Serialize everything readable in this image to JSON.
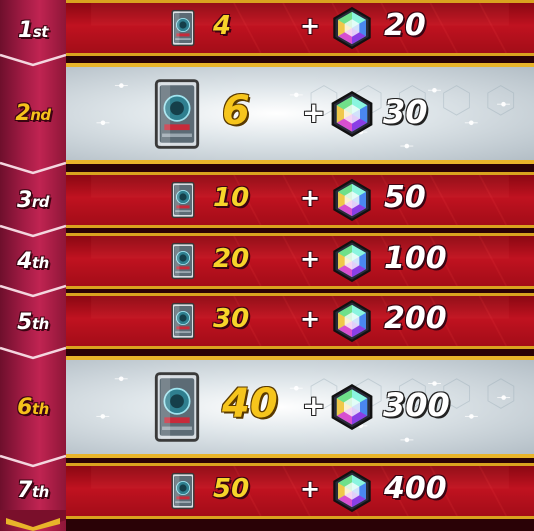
{
  "rewards": [
    {
      "rank_num": "1",
      "rank_suffix": "st",
      "packs": "4",
      "gems": "20",
      "highlight": false
    },
    {
      "rank_num": "2",
      "rank_suffix": "nd",
      "packs": "6",
      "gems": "30",
      "highlight": true
    },
    {
      "rank_num": "3",
      "rank_suffix": "rd",
      "packs": "10",
      "gems": "50",
      "highlight": false
    },
    {
      "rank_num": "4",
      "rank_suffix": "th",
      "packs": "20",
      "gems": "100",
      "highlight": false
    },
    {
      "rank_num": "5",
      "rank_suffix": "th",
      "packs": "30",
      "gems": "200",
      "highlight": false
    },
    {
      "rank_num": "6",
      "rank_suffix": "th",
      "packs": "40",
      "gems": "300",
      "highlight": true
    },
    {
      "rank_num": "7",
      "rank_suffix": "th",
      "packs": "50",
      "gems": "400",
      "highlight": false
    }
  ],
  "plus_symbol": "+",
  "icons": {
    "pack": "card-pack-icon",
    "gem": "gem-icon"
  },
  "colors": {
    "row_red": "#c01220",
    "row_silver": "#dfe6ea",
    "gold_border": "#d9a31f",
    "ribbon": "#a11b44",
    "rank_gold": "#f5c11b",
    "pack_qty": "#f7d42a"
  }
}
